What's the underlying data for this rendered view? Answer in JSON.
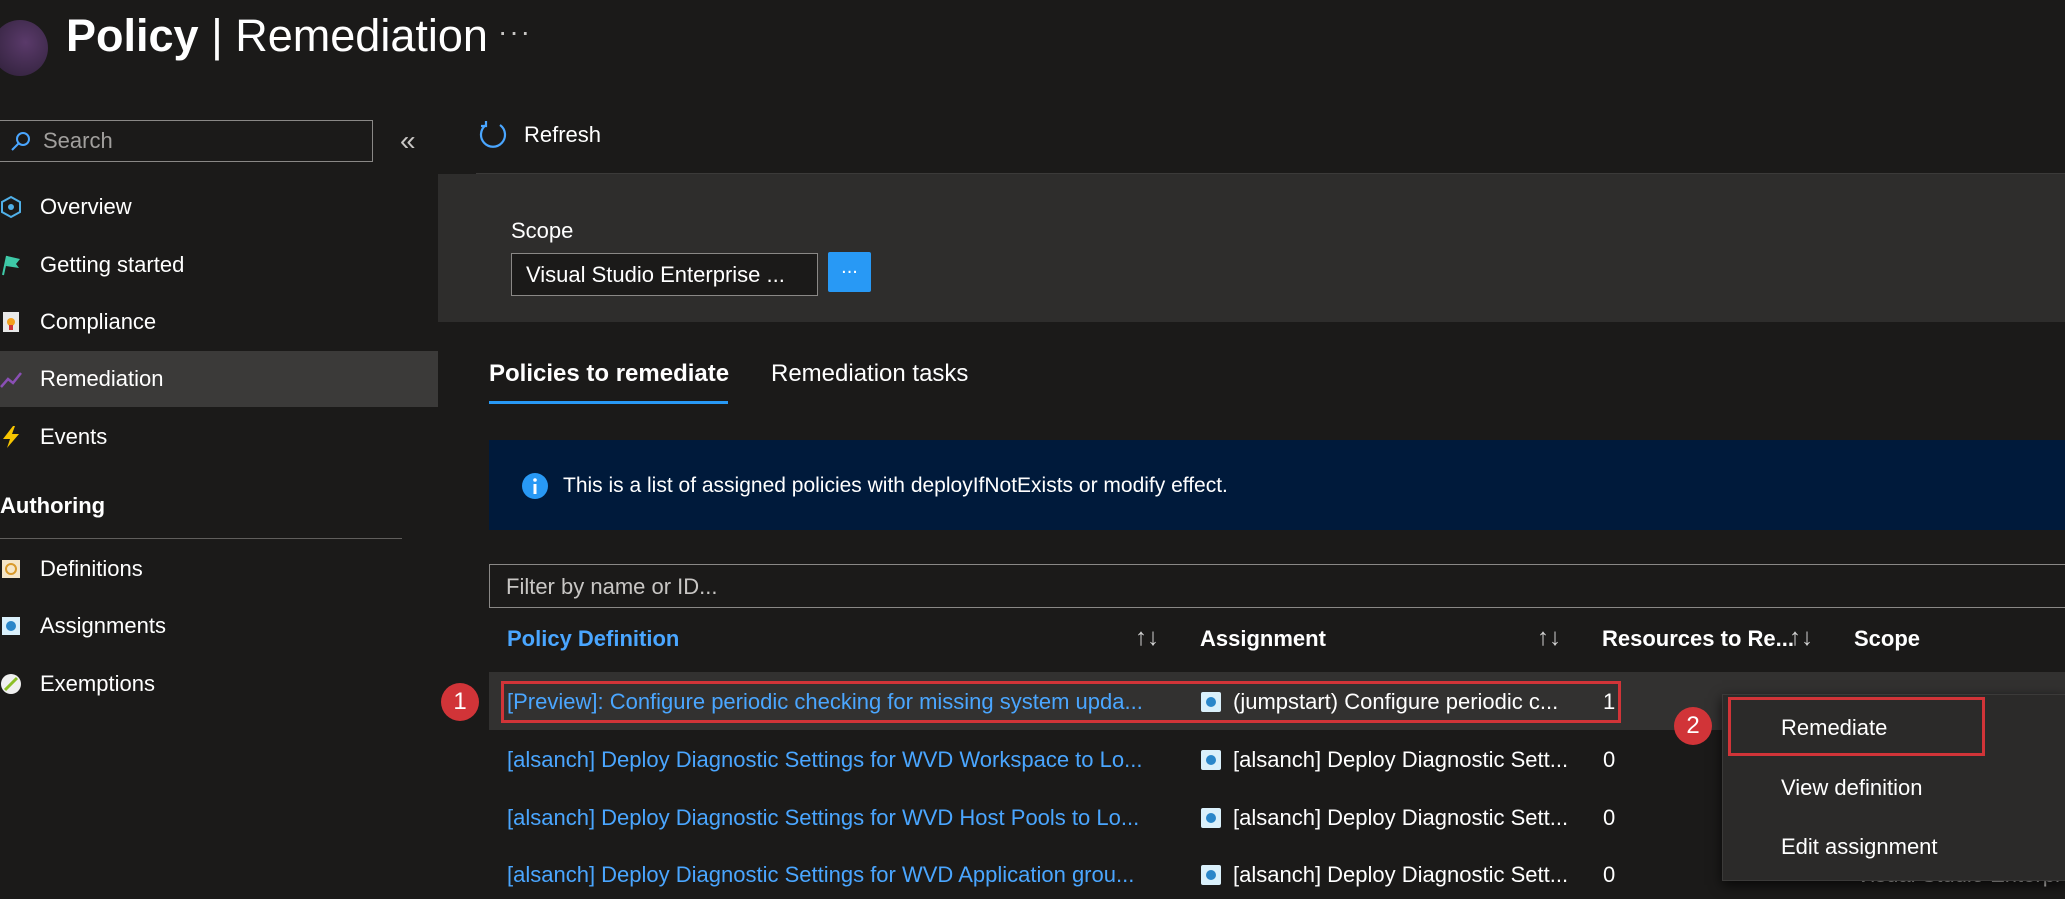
{
  "header": {
    "title_bold": "Policy",
    "title_rest": "| Remediation",
    "more_label": "···"
  },
  "sidebar": {
    "search_placeholder": "Search",
    "collapse_label": "«",
    "items": [
      {
        "label": "Overview",
        "icon": "overview-icon"
      },
      {
        "label": "Getting started",
        "icon": "flag-icon"
      },
      {
        "label": "Compliance",
        "icon": "compliance-icon"
      },
      {
        "label": "Remediation",
        "icon": "remediation-icon",
        "selected": true
      },
      {
        "label": "Events",
        "icon": "lightning-icon"
      }
    ],
    "authoring_heading": "Authoring",
    "authoring_items": [
      {
        "label": "Definitions",
        "icon": "definition-icon"
      },
      {
        "label": "Assignments",
        "icon": "assignment-icon"
      },
      {
        "label": "Exemptions",
        "icon": "exemption-icon"
      }
    ]
  },
  "toolbar": {
    "refresh_label": "Refresh"
  },
  "scope": {
    "label": "Scope",
    "value": "Visual Studio Enterprise ...",
    "button_label": "..."
  },
  "tabs": [
    {
      "label": "Policies to remediate",
      "active": true
    },
    {
      "label": "Remediation tasks",
      "active": false
    }
  ],
  "info": {
    "text": "This is a list of assigned policies with deployIfNotExists or modify effect."
  },
  "filter": {
    "placeholder": "Filter by name or ID..."
  },
  "table": {
    "columns": [
      "Policy Definition",
      "Assignment",
      "Resources to Re...",
      "Scope"
    ],
    "sort_glyph": "↑↓",
    "rows": [
      {
        "policy": "[Preview]: Configure periodic checking for missing system upda...",
        "assignment": "(jumpstart) Configure periodic c...",
        "resources": "1"
      },
      {
        "policy": "[alsanch] Deploy Diagnostic Settings for WVD Workspace to Lo...",
        "assignment": "[alsanch] Deploy Diagnostic Sett...",
        "resources": "0"
      },
      {
        "policy": "[alsanch] Deploy Diagnostic Settings for WVD Host Pools to Lo...",
        "assignment": "[alsanch] Deploy Diagnostic Sett...",
        "resources": "0"
      },
      {
        "policy": "[alsanch] Deploy Diagnostic Settings for WVD Application grou...",
        "assignment": "[alsanch] Deploy Diagnostic Sett...",
        "resources": "0"
      }
    ],
    "scope_peek": "Visual Studio Enterpr"
  },
  "context_menu": {
    "items": [
      "Remediate",
      "View definition",
      "Edit assignment"
    ]
  },
  "callouts": {
    "first": "1",
    "second": "2"
  },
  "colors": {
    "accent": "#2899f5",
    "link": "#4aa6ff",
    "highlight": "#d13438",
    "background": "#1b1a19"
  }
}
